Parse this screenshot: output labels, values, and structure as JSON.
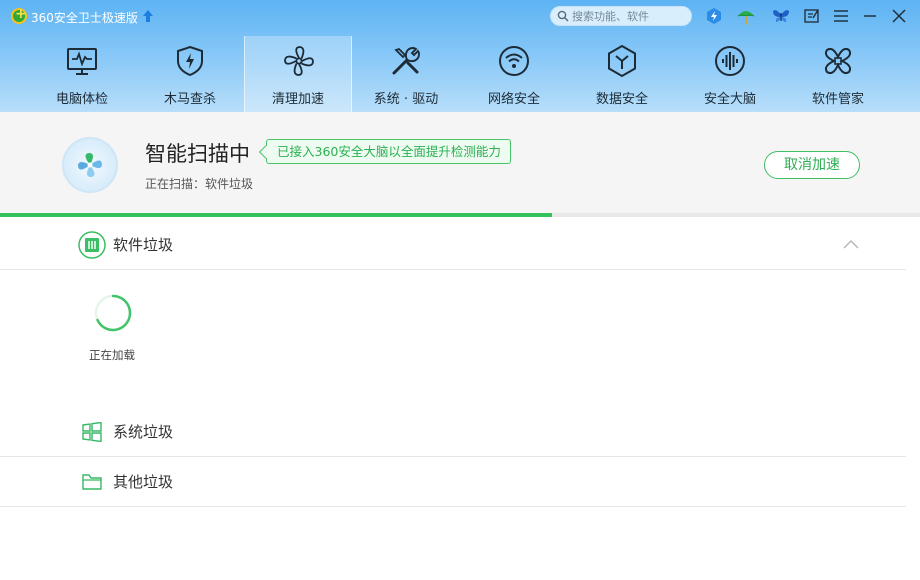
{
  "app": {
    "title": "360安全卫士极速版"
  },
  "search": {
    "placeholder": "搜索功能、软件"
  },
  "titlebar_icons": [
    "upgrade-arrow-icon",
    "lightning-icon",
    "umbrella-icon",
    "butterfly-icon",
    "feedback-icon",
    "menu-icon",
    "minimize-icon",
    "close-icon"
  ],
  "nav": {
    "items": [
      {
        "label": "电脑体检",
        "icon": "monitor-pulse-icon",
        "active": false
      },
      {
        "label": "木马查杀",
        "icon": "shield-bolt-icon",
        "active": false
      },
      {
        "label": "清理加速",
        "icon": "fan-icon",
        "active": true
      },
      {
        "label": "系统 · 驱动",
        "icon": "wrench-screwdriver-icon",
        "active": false
      },
      {
        "label": "网络安全",
        "icon": "wifi-icon",
        "active": false
      },
      {
        "label": "数据安全",
        "icon": "hexagon-y-icon",
        "active": false
      },
      {
        "label": "安全大脑",
        "icon": "brain-wave-icon",
        "active": false
      },
      {
        "label": "软件管家",
        "icon": "clover-icon",
        "active": false
      }
    ]
  },
  "scan": {
    "title": "智能扫描中",
    "badge": "已接入360安全大脑以全面提升检测能力",
    "status": "正在扫描：软件垃圾",
    "cancel_label": "取消加速",
    "progress": 0.6
  },
  "categories": [
    {
      "label": "软件垃圾",
      "icon": "trash-bin-icon",
      "expanded": true
    },
    {
      "label": "系统垃圾",
      "icon": "windows-logo-icon",
      "expanded": false
    },
    {
      "label": "其他垃圾",
      "icon": "folder-icon",
      "expanded": false
    }
  ],
  "loading": {
    "label": "正在加载"
  },
  "colors": {
    "accent_green": "#35c25c",
    "header_blue": "#5db3f3"
  }
}
